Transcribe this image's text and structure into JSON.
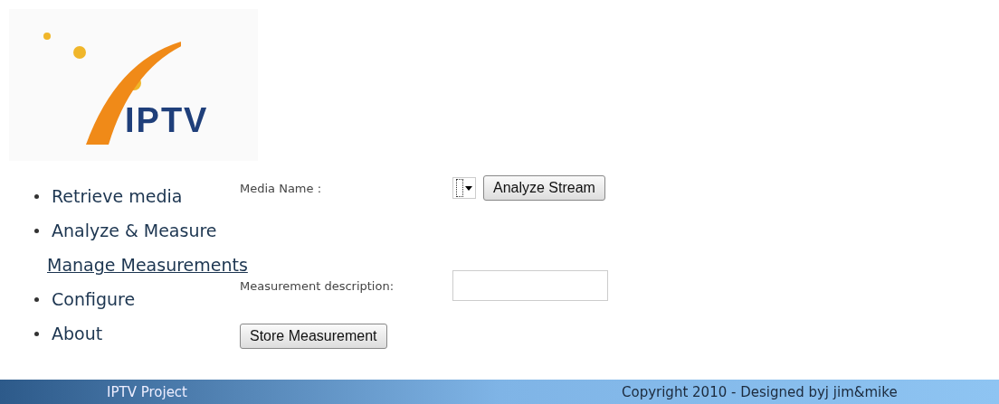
{
  "logo": {
    "text": "IPTV"
  },
  "nav": [
    {
      "label": "Retrieve media",
      "selected": false
    },
    {
      "label": "Analyze & Measure",
      "selected": false
    },
    {
      "label": "Manage Measurements",
      "selected": true
    },
    {
      "label": "Configure",
      "selected": false
    },
    {
      "label": "About",
      "selected": false
    }
  ],
  "form": {
    "media_label": "Media Name :",
    "analyze_button": "Analyze Stream",
    "description_label": "Measurement description:",
    "store_button": "Store Measurement"
  },
  "footer": {
    "left": "IPTV Project",
    "right": "Copyright 2010 - Designed byj jim&mike"
  }
}
